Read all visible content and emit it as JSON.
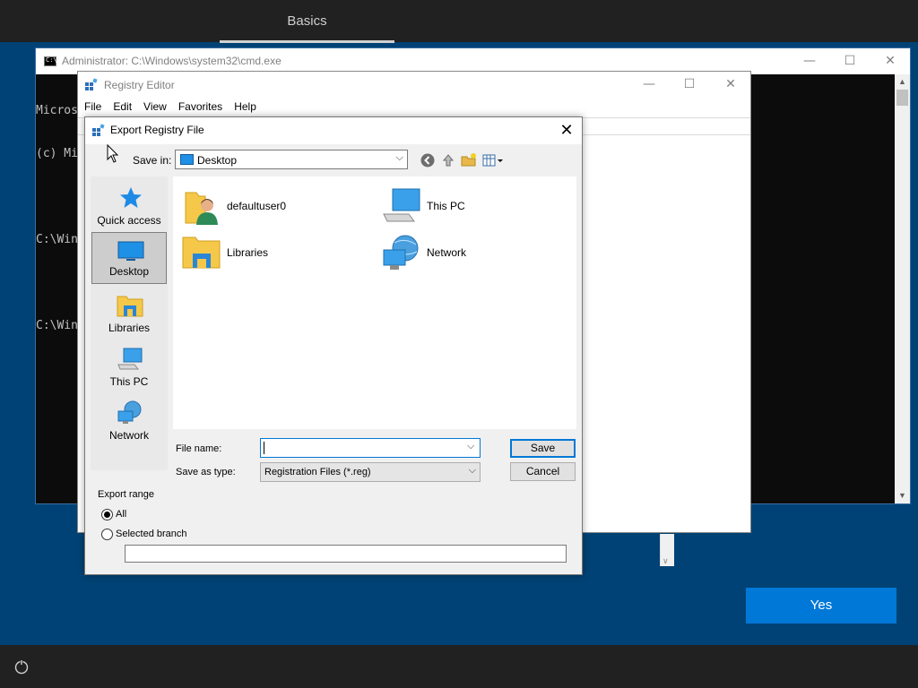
{
  "oobe": {
    "tab_label": "Basics",
    "yes_label": "Yes",
    "accessibility_icon": "accessibility-icon",
    "accent_color": "#0078d7"
  },
  "cmd": {
    "title": "Administrator: C:\\Windows\\system32\\cmd.exe",
    "lines": [
      "Micros",
      "(c) Mi",
      "",
      "C:\\Win",
      "",
      "C:\\Win"
    ],
    "minimize": "—",
    "maximize": "☐",
    "close": "✕"
  },
  "regedit": {
    "title": "Registry Editor",
    "menu": [
      "File",
      "Edit",
      "View",
      "Favorites",
      "Help"
    ],
    "minimize": "—",
    "maximize": "☐",
    "close": "✕"
  },
  "dialog": {
    "title": "Export Registry File",
    "close": "✕",
    "save_in_label": "Save in:",
    "save_in_value": "Desktop",
    "places": [
      {
        "label": "Quick access",
        "icon": "star-icon"
      },
      {
        "label": "Desktop",
        "icon": "desktop-icon",
        "selected": true
      },
      {
        "label": "Libraries",
        "icon": "libraries-icon"
      },
      {
        "label": "This PC",
        "icon": "computer-icon"
      },
      {
        "label": "Network",
        "icon": "network-icon"
      }
    ],
    "files": [
      {
        "label": "defaultuser0",
        "icon": "user-folder-icon"
      },
      {
        "label": "This PC",
        "icon": "computer-icon"
      },
      {
        "label": "Libraries",
        "icon": "libraries-icon"
      },
      {
        "label": "Network",
        "icon": "network-icon"
      }
    ],
    "file_name_label": "File name:",
    "file_name_value": "",
    "save_as_type_label": "Save as type:",
    "save_as_type_value": "Registration Files (*.reg)",
    "save_label": "Save",
    "cancel_label": "Cancel",
    "export_range_label": "Export range",
    "range_all_label": "All",
    "range_branch_label": "Selected branch",
    "branch_value": ""
  }
}
